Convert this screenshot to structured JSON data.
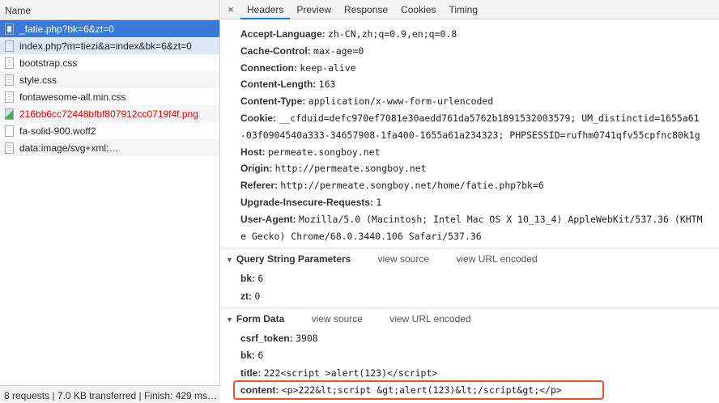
{
  "left": {
    "header": "Name",
    "items": [
      {
        "name": "_fatie.php?bk=6&zt=0",
        "icon": "document-icon",
        "state": "selected"
      },
      {
        "name": "index.php?m=tiezi&a=index&bk=6&zt=0",
        "icon": "document-icon",
        "state": "highlight"
      },
      {
        "name": "bootstrap.css",
        "icon": "document-icon"
      },
      {
        "name": "style.css",
        "icon": "document-icon"
      },
      {
        "name": "fontawesome-all.min.css",
        "icon": "document-icon"
      },
      {
        "name": "216bb6cc72448bfbf807912cc0719f4f.png",
        "icon": "image-icon",
        "state": "error"
      },
      {
        "name": "fa-solid-900.woff2",
        "icon": "blank-file-icon"
      },
      {
        "name": "data:image/svg+xml;…",
        "icon": "document-icon"
      }
    ],
    "status": "8 requests | 7.0 KB transferred | Finish: 429 ms…"
  },
  "tabs": [
    "Headers",
    "Preview",
    "Response",
    "Cookies",
    "Timing"
  ],
  "request_headers": [
    {
      "k": "Accept-Language:",
      "v": "zh-CN,zh;q=0.9,en;q=0.8"
    },
    {
      "k": "Cache-Control:",
      "v": "max-age=0"
    },
    {
      "k": "Connection:",
      "v": "keep-alive"
    },
    {
      "k": "Content-Length:",
      "v": "163"
    },
    {
      "k": "Content-Type:",
      "v": "application/x-www-form-urlencoded"
    },
    {
      "k": "Cookie:",
      "v": "__cfduid=defc970ef7081e30aedd761da5762b1891532003579; UM_distinctid=1655a61"
    },
    {
      "k": "",
      "v": "-03f0904540a333-34657908-1fa400-1655a61a234323; PHPSESSID=rufhm0741qfv55cpfnc80k1g"
    },
    {
      "k": "Host:",
      "v": "permeate.songboy.net"
    },
    {
      "k": "Origin:",
      "v": "http://permeate.songboy.net"
    },
    {
      "k": "Referer:",
      "v": "http://permeate.songboy.net/home/fatie.php?bk=6"
    },
    {
      "k": "Upgrade-Insecure-Requests:",
      "v": "1"
    },
    {
      "k": "User-Agent:",
      "v": "Mozilla/5.0 (Macintosh; Intel Mac OS X 10_13_4) AppleWebKit/537.36 (KHTM"
    },
    {
      "k": "",
      "v": "e Gecko) Chrome/68.0.3440.106 Safari/537.36"
    }
  ],
  "query": {
    "title": "Query String Parameters",
    "view_source": "view source",
    "view_url": "view URL encoded",
    "params": [
      {
        "k": "bk:",
        "v": "6"
      },
      {
        "k": "zt:",
        "v": "0"
      }
    ]
  },
  "form": {
    "title": "Form Data",
    "view_source": "view source",
    "view_url": "view URL encoded",
    "params": [
      {
        "k": "csrf_token:",
        "v": "3908"
      },
      {
        "k": "bk:",
        "v": "6"
      },
      {
        "k": "title:",
        "v": "222<script >alert(123)</script>"
      },
      {
        "k": "content:",
        "v": "<p>222&lt;script &gt;alert(123)&lt;/script&gt;</p>"
      }
    ]
  },
  "colors": {
    "accent": "#3879d9",
    "highlight_box": "#f0502a",
    "error": "#e00000"
  }
}
